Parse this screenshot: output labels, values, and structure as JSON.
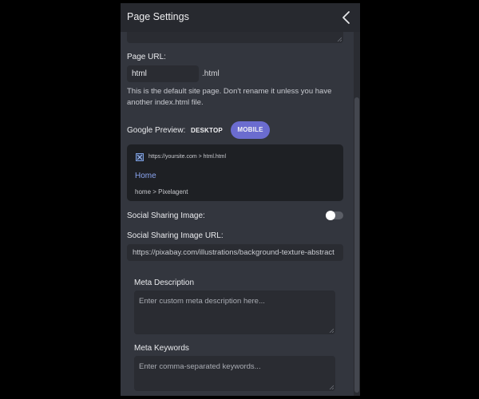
{
  "header": {
    "title": "Page Settings",
    "back_icon": "chevron-left-icon"
  },
  "page_url": {
    "label": "Page URL:",
    "value": "html",
    "suffix": ".html",
    "help": "This is the default site page. Don't rename it unless you have another index.html file."
  },
  "google_preview": {
    "label": "Google Preview:",
    "tabs": [
      "DESKTOP",
      "MOBILE"
    ],
    "active_tab": "MOBILE",
    "url": "https://yoursite.com > html.html",
    "title": "Home",
    "breadcrumb": "home > Pixelagent",
    "favicon_icon": "broken-image-icon"
  },
  "social_sharing": {
    "label": "Social Sharing Image:",
    "enabled": false,
    "url_label": "Social Sharing Image URL:",
    "url_value": "https://pixabay.com/illustrations/background-texture-abstract"
  },
  "meta_description": {
    "label": "Meta Description",
    "placeholder": "Enter custom meta description here..."
  },
  "meta_keywords": {
    "label": "Meta Keywords",
    "placeholder": "Enter comma-separated keywords..."
  },
  "colors": {
    "panel_bg": "#33363e",
    "header_bg": "#27292f",
    "accent": "#6b6ccf",
    "link": "#8aa4f0"
  }
}
